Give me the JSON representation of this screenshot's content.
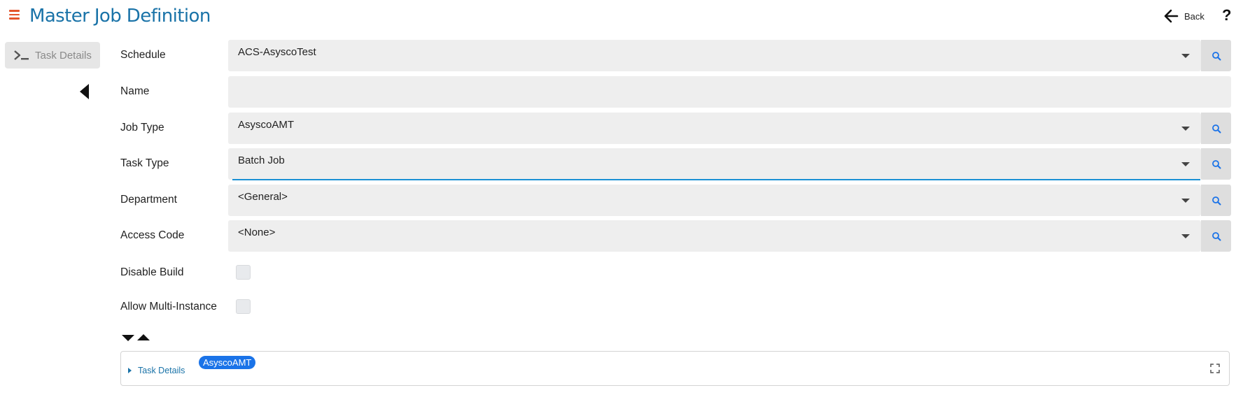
{
  "header": {
    "title": "Master Job Definition",
    "back_label": "Back",
    "help_label": "?"
  },
  "sidebar": {
    "items": [
      {
        "label": "Task Details",
        "icon": "terminal-icon"
      }
    ]
  },
  "form": {
    "schedule": {
      "label": "Schedule",
      "value": "ACS-AsyscoTest"
    },
    "name": {
      "label": "Name",
      "value": ""
    },
    "job_type": {
      "label": "Job Type",
      "value": "AsyscoAMT"
    },
    "task_type": {
      "label": "Task Type",
      "value": "Batch Job"
    },
    "department": {
      "label": "Department",
      "value": "<General>"
    },
    "access_code": {
      "label": "Access Code",
      "value": "<None>"
    },
    "disable_build": {
      "label": "Disable Build",
      "checked": false
    },
    "allow_multi_instance": {
      "label": "Allow Multi-Instance",
      "checked": false
    }
  },
  "panel": {
    "title": "Task Details",
    "badge": "AsyscoAMT"
  },
  "colors": {
    "accent": "#1a73a8",
    "menu_icon": "#e4542a",
    "focus": "#1a90d4",
    "badge": "#1a73e8",
    "field_bg": "#eeeeee"
  }
}
